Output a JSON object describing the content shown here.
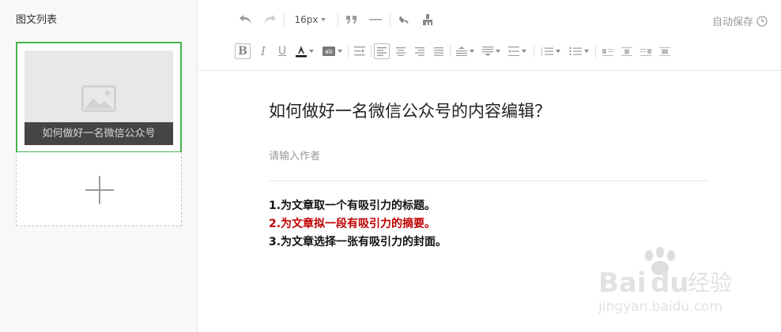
{
  "sidebar": {
    "title": "图文列表",
    "article_card": {
      "title": "如何做好一名微信公众号"
    }
  },
  "toolbar": {
    "font_size": "16px",
    "autosave": "自动保存",
    "icons": [
      "undo-icon",
      "redo-icon",
      "font-size-select",
      "blockquote-icon",
      "horizontal-rule-icon",
      "format-brush-icon",
      "clear-format-icon",
      "bold-icon",
      "italic-icon",
      "underline-icon",
      "font-color-icon",
      "background-color-icon",
      "indent-icon",
      "align-left-icon",
      "align-center-icon",
      "align-right-icon",
      "align-justify-icon",
      "line-height-before-icon",
      "line-height-after-icon",
      "letter-spacing-icon",
      "ordered-list-icon",
      "unordered-list-icon",
      "float-left-icon",
      "float-center-icon",
      "float-right-icon",
      "float-none-icon"
    ]
  },
  "editor": {
    "title": "如何做好一名微信公众号的内容编辑？",
    "author_placeholder": "请输入作者",
    "lines": [
      {
        "text": "1.为文章取一个有吸引力的标题。",
        "color": "#111111"
      },
      {
        "text": "2.为文章拟一段有吸引力的摘要。",
        "color": "#c00000"
      },
      {
        "text": "3.为文章选择一张有吸引力的封面。",
        "color": "#111111"
      }
    ]
  },
  "watermark": {
    "brand": "Bai",
    "brand2": "du",
    "brand_cn": "经验",
    "url": "jingyan.baidu.com"
  },
  "colors": {
    "accent": "#44b549",
    "red": "#c00000"
  }
}
